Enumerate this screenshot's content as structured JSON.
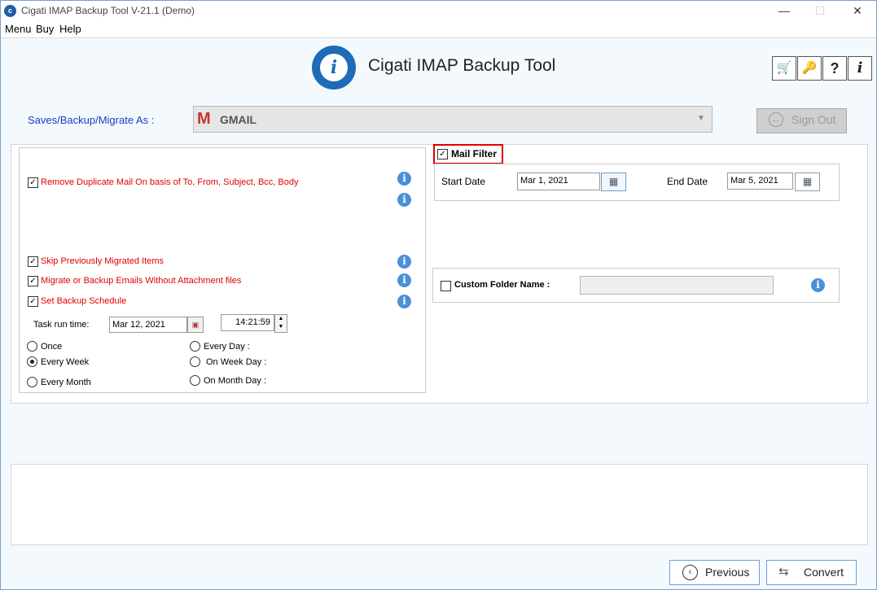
{
  "window": {
    "title": "Cigati IMAP Backup Tool V-21.1 (Demo)",
    "controls": {
      "minimize": "—",
      "maximize": "☐",
      "close": "✕"
    }
  },
  "menu": [
    "Menu",
    "Buy",
    "Help"
  ],
  "header": {
    "logo_letter": "i",
    "app_title": "Cigati IMAP Backup Tool",
    "toolbar": [
      {
        "name": "cart-icon",
        "glyph": "🛒"
      },
      {
        "name": "key-icon",
        "glyph": "🔑"
      },
      {
        "name": "help-icon",
        "glyph": "?"
      },
      {
        "name": "info-icon",
        "glyph": "i"
      }
    ]
  },
  "saves": {
    "label": "Saves/Backup/Migrate As :",
    "selected": "GMAIL",
    "sign_out": "Sign Out"
  },
  "options": {
    "remove_duplicate": "Remove Duplicate Mail On basis of To, From, Subject, Bcc, Body",
    "skip_migrated": "Skip Previously Migrated Items",
    "without_attachment": "Migrate or Backup Emails Without Attachment files",
    "set_schedule": "Set Backup Schedule",
    "task_run_time_label": "Task run time:",
    "task_date": "Mar 12, 2021",
    "task_time": "14:21:59",
    "radios_left": [
      "Once",
      "Every Week",
      "Every Month"
    ],
    "radios_right": [
      "Every Day :",
      "On Week Day :",
      "On Month Day :"
    ],
    "selected_radio": "Every Week"
  },
  "mail_filter": {
    "label": "Mail Filter",
    "checked": true,
    "start_label": "Start Date",
    "start_value": "Mar 1, 2021",
    "end_label": "End Date",
    "end_value": "Mar 5, 2021"
  },
  "custom_folder": {
    "label": "Custom Folder Name :",
    "value": ""
  },
  "footer": {
    "previous": "Previous",
    "convert": "Convert"
  },
  "colors": {
    "accent_blue": "#1e6bb8",
    "label_blue": "#1a3cc8",
    "option_red": "#e00000",
    "client_bg": "#f4f9fd"
  }
}
